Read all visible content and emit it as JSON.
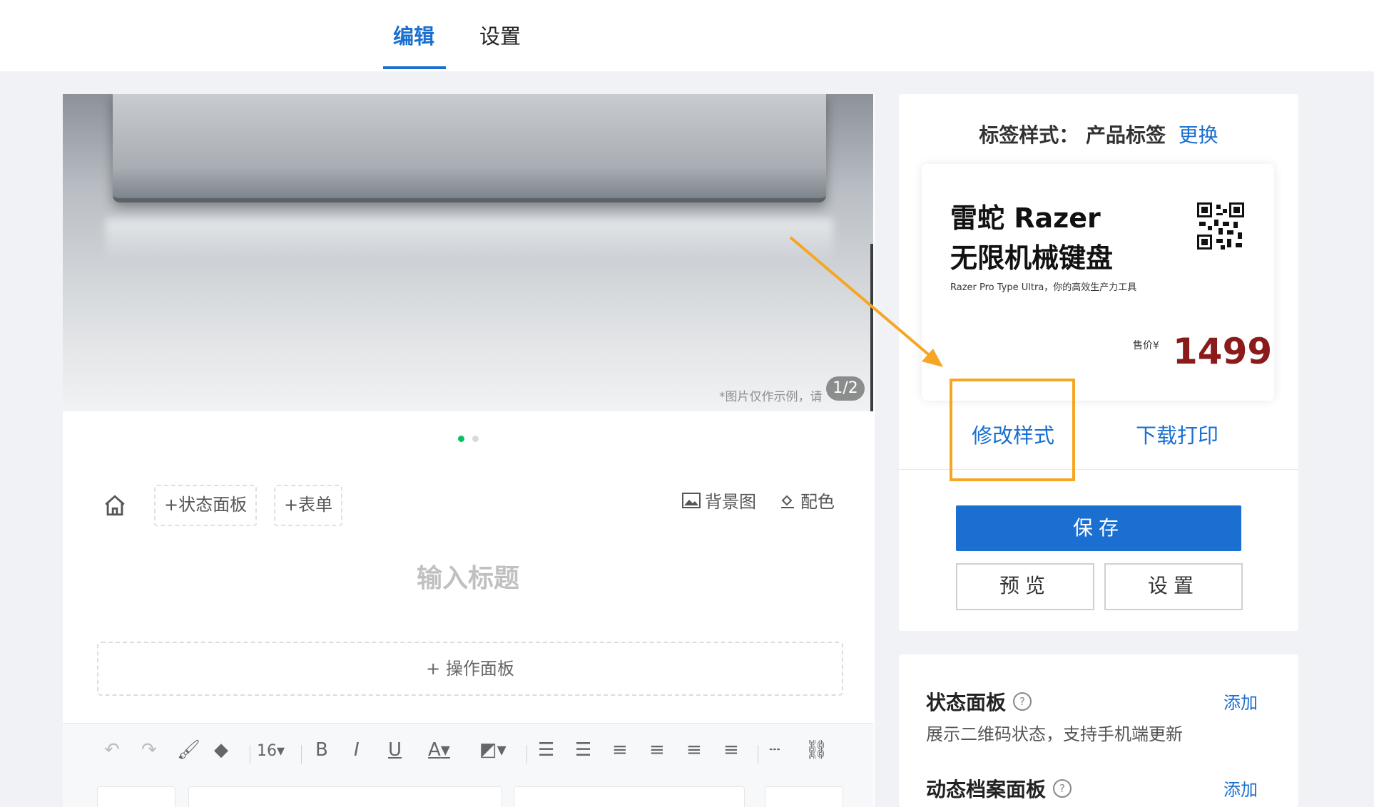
{
  "tabs": [
    {
      "label": "编辑",
      "active": true
    },
    {
      "label": "设置",
      "active": false
    }
  ],
  "editor": {
    "banner": {
      "note": "*图片仅作示例，请",
      "counter": "1/2"
    },
    "carousel_dots": {
      "active_index": 0,
      "count": 2,
      "active_color": "#07c160",
      "inactive_color": "#d9d9d9"
    },
    "buttons": {
      "home_icon": "home-icon",
      "status_panel": "+状态面板",
      "form": "+表单",
      "background": "背景图",
      "color_scheme": "配色"
    },
    "title_placeholder": "输入标题",
    "op_panel": "+ 操作面板",
    "toolbar": {
      "font_size": "16",
      "bold": "B",
      "italic": "I",
      "underline": "U",
      "font_color": "A"
    }
  },
  "label_card": {
    "style_label": "标签样式：",
    "style_value": "产品标签",
    "change": "更换",
    "preview": {
      "title_line1": "雷蛇 Razer",
      "title_line2": "无限机械键盘",
      "subtitle": "Razer Pro Type Ultra，你的高效生产力工具",
      "price_label": "售价¥",
      "price": "1499"
    },
    "modify_style": "修改样式",
    "download_print": "下载打印",
    "save": "保存",
    "preview_btn": "预览",
    "settings_btn": "设置"
  },
  "panels": [
    {
      "title": "状态面板",
      "add": "添加",
      "desc": "展示二维码状态，支持手机端更新"
    },
    {
      "title": "动态档案面板",
      "add": "添加"
    }
  ],
  "colors": {
    "accent": "#1a6fd1",
    "price": "#8b1a1a",
    "annotation": "#f5a623"
  }
}
